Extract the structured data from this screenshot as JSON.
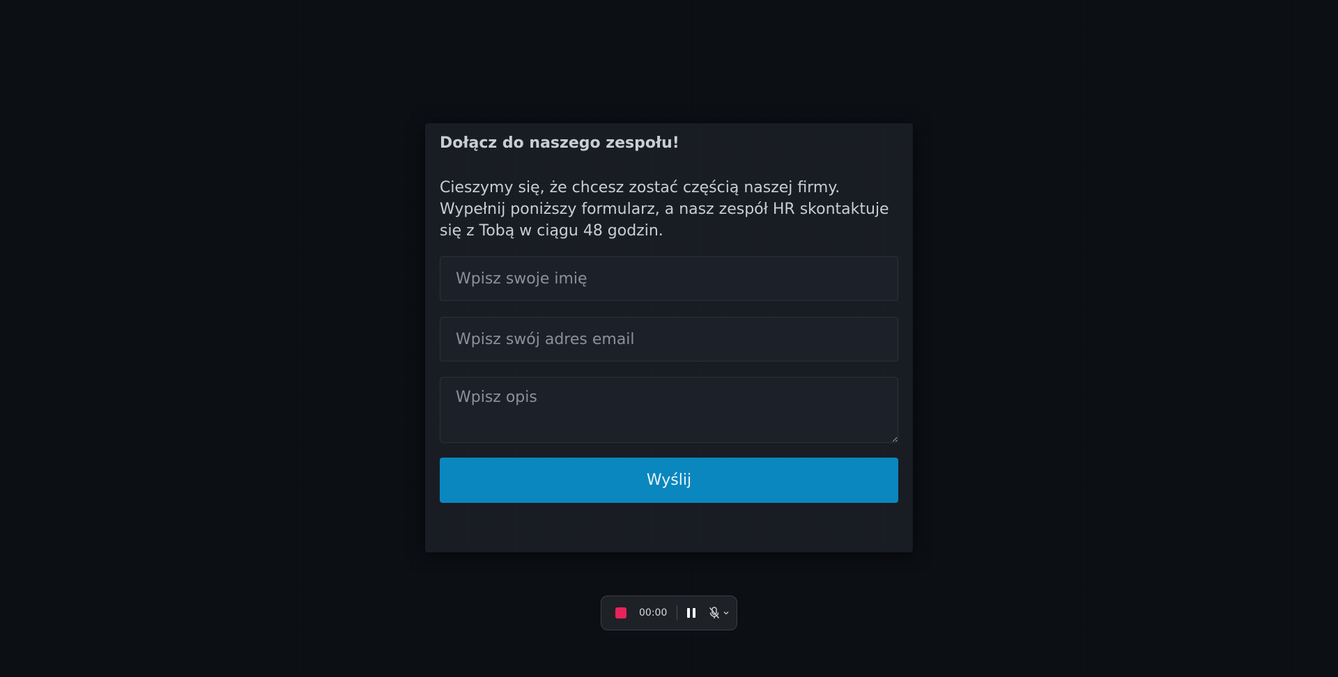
{
  "form": {
    "title": "Dołącz do naszego zespołu!",
    "description": "Cieszymy się, że chcesz zostać częścią naszej firmy. Wypełnij poniższy formularz, a nasz zespół HR skontaktuje się z Tobą w ciągu 48 godzin.",
    "name_placeholder": "Wpisz swoje imię",
    "name_value": "",
    "email_placeholder": "Wpisz swój adres email",
    "email_value": "",
    "description_placeholder": "Wpisz opis",
    "description_value": "",
    "submit_label": "Wyślij"
  },
  "recorder": {
    "timer": "00:00",
    "icons": [
      "stop-icon",
      "pause-icon",
      "microphone-muted-icon",
      "chevron-down-icon"
    ]
  },
  "colors": {
    "background": "#0a0d12",
    "card": "#171b22",
    "accent": "#0a87be",
    "record": "#e8235c"
  }
}
